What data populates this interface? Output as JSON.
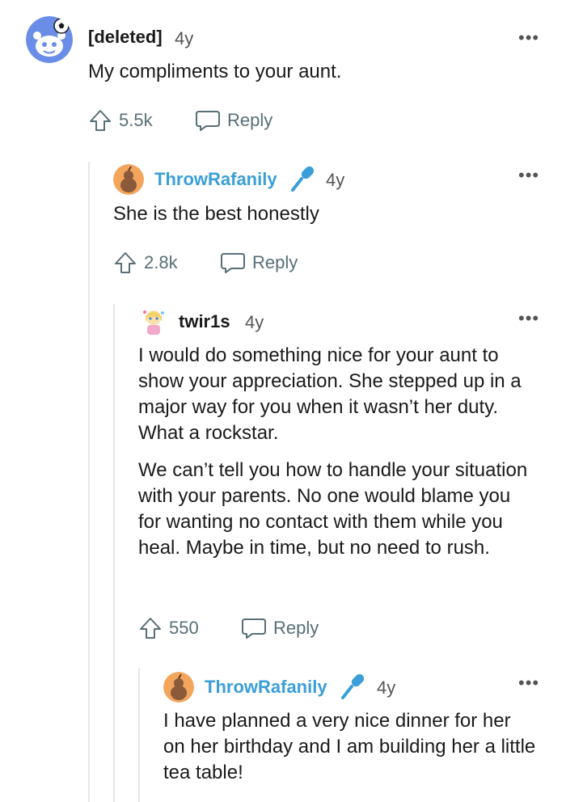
{
  "comments": [
    {
      "username": "[deleted]",
      "age": "4y",
      "paragraphs": [
        "My compliments to your aunt."
      ],
      "votes": "5.5k",
      "reply_label": "Reply",
      "menu_label": "•••"
    },
    {
      "username": "ThrowRafanily",
      "age": "4y",
      "paragraphs": [
        "She is the best honestly"
      ],
      "votes": "2.8k",
      "reply_label": "Reply",
      "menu_label": "•••"
    },
    {
      "username": "twir1s",
      "age": "4y",
      "paragraphs": [
        "I would do something nice for your aunt to show your appreciation. She stepped up in a major way for you when it wasn’t her duty. What a rockstar.",
        "We can’t tell you how to handle your situation with your parents. No one would blame you for wanting no contact with them while you heal. Maybe in time, but no need to rush."
      ],
      "votes": "550",
      "reply_label": "Reply",
      "menu_label": "•••"
    },
    {
      "username": "ThrowRafanily",
      "age": "4y",
      "paragraphs": [
        "I have planned a very nice dinner for her on her birthday and I am building her a little tea table!"
      ],
      "menu_label": "•••"
    }
  ],
  "colors": {
    "op_username": "#3a9fd8",
    "mic_badge": "#3a9fd8",
    "thread_line": "#e4e6e8",
    "action_gray": "#576f76"
  },
  "icons": {
    "upvote": "arrow-up-outline-icon",
    "reply": "speech-bubble-icon",
    "op_badge": "microphone-icon"
  }
}
